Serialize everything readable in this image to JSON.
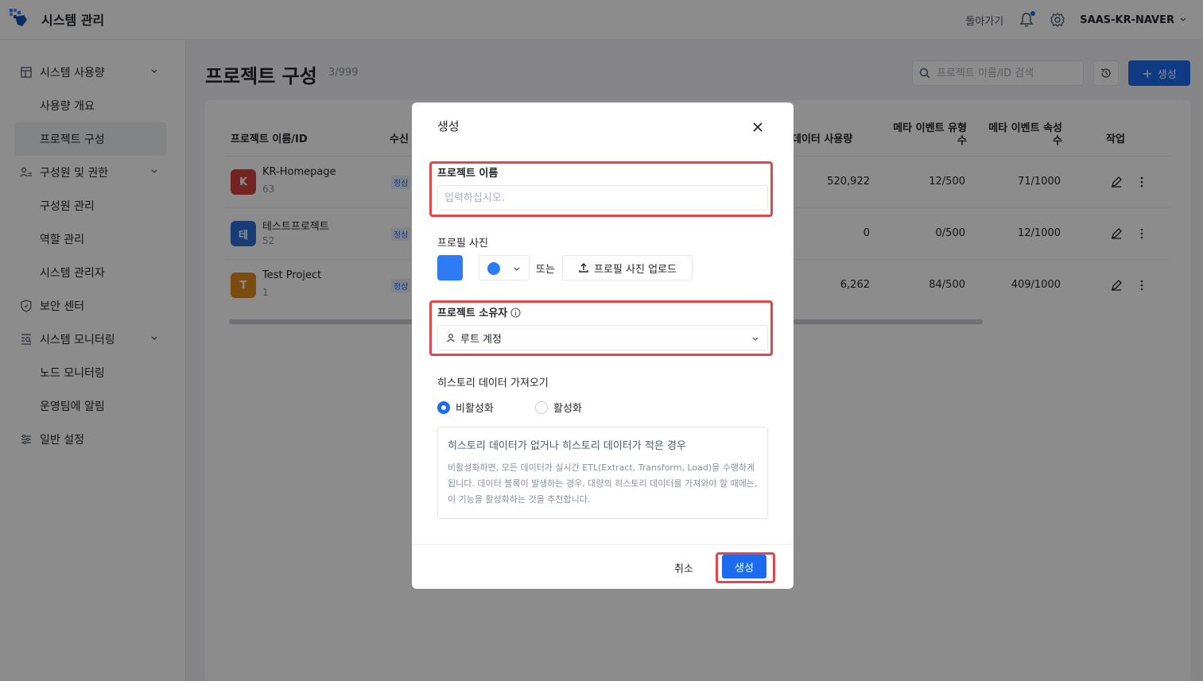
{
  "header": {
    "app_title": "시스템 관리",
    "back_label": "돌아가기",
    "workspace": "SAAS-KR-NAVER"
  },
  "sidebar": {
    "items": [
      {
        "label": "시스템 사용량",
        "icon": "dashboard-icon",
        "expandable": true
      },
      {
        "label": "사용량 개요"
      },
      {
        "label": "프로젝트 구성",
        "active": true
      },
      {
        "label": "구성원 및 권한",
        "icon": "users-icon",
        "expandable": true
      },
      {
        "label": "구성원 관리"
      },
      {
        "label": "역할 관리"
      },
      {
        "label": "시스템 관리자"
      },
      {
        "label": "보안 센터",
        "icon": "shield-icon"
      },
      {
        "label": "시스템 모니터링",
        "icon": "monitor-icon",
        "expandable": true
      },
      {
        "label": "노드 모니터링"
      },
      {
        "label": "운영팀에 알림"
      },
      {
        "label": "일반 설정",
        "icon": "sliders-icon"
      }
    ]
  },
  "main": {
    "title": "프로젝트 구성",
    "count": "3/999",
    "search_placeholder": "프로젝트 이름/ID 검색",
    "create_label": "생성"
  },
  "table": {
    "headers": {
      "name": "프로젝트 이름/ID",
      "recv": "수신",
      "data_usage": "데이터 사용량",
      "meta_event_type": "메타 이벤트 유형\n수",
      "meta_event_type_l1": "메타 이벤트 유형",
      "meta_event_type_l2": "수",
      "meta_event_prop_l1": "메타 이벤트 속성",
      "meta_event_prop_l2": "수",
      "action": "작업"
    },
    "rows": [
      {
        "initial": "K",
        "color": "#d4433b",
        "name": "KR-Homepage",
        "id": "63",
        "status": "정상",
        "usage": "520,922",
        "types": "12/500",
        "props": "71/1000"
      },
      {
        "initial": "테",
        "color": "#2d6fd6",
        "name": "테스트프로젝트",
        "id": "52",
        "status": "정상",
        "usage": "0",
        "types": "0/500",
        "props": "12/1000"
      },
      {
        "initial": "T",
        "color": "#e08a1e",
        "name": "Test Project",
        "id": "1",
        "status": "정상",
        "usage": "6,262",
        "types": "84/500",
        "props": "409/1000"
      }
    ]
  },
  "modal": {
    "title": "생성",
    "project_name_label": "프로젝트 이름",
    "project_name_placeholder": "입력하십시오.",
    "profile_label": "프로필 사진",
    "profile_color": "#2d7cf6",
    "or_text": "또는",
    "upload_label": "프로필 사진 업로드",
    "owner_label": "프로젝트 소유자",
    "owner_value": "루트 계정",
    "history_label": "히스토리 데이터 가져오기",
    "radio_off": "비활성화",
    "radio_on": "활성화",
    "radio_selected": "비활성화",
    "notice_title": "히스토리 데이터가 없거나 히스토리 데이터가 적은 경우",
    "notice_body": "비활성화하면, 모든 데이터가 실시간 ETL(Extract, Transform, Load)을 수행하게 됩니다. 데이터 블록이 발생하는 경우, 대량의 히스토리 데이터를 가져와야 할 때에는, 이 기능을 활성화하는 것을 추천합니다.",
    "cancel_label": "취소",
    "confirm_label": "생성"
  },
  "colors": {
    "accent": "#1d6cf0",
    "highlight": "#e0474c"
  }
}
